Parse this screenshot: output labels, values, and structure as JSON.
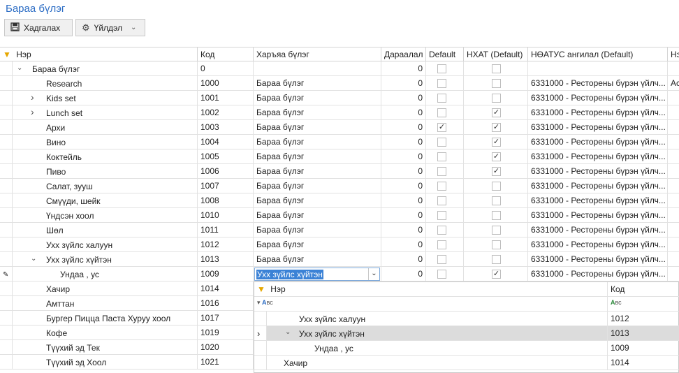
{
  "window": {
    "title": "Бараа бүлэг"
  },
  "toolbar": {
    "close_label": "Хадгалах",
    "actions_label": "Үйлдэл"
  },
  "columns": [
    "Нэр",
    "Код",
    "Харъяа бүлэг",
    "Дараалал",
    "Default",
    "НХАТ (Default)",
    "НӨАТУС ангилал (Default)",
    "Нэ"
  ],
  "rows": [
    {
      "name": "Бараа бүлэг",
      "code": "0",
      "parent": "",
      "order": "0",
      "def": false,
      "nhat": false,
      "vat": "",
      "extra": "",
      "level": 0,
      "expander": "down"
    },
    {
      "name": "Research",
      "code": "1000",
      "parent": "Бараа бүлэг",
      "order": "0",
      "def": false,
      "nhat": false,
      "vat": "6331000 - Ресторены бүрэн үйлч...",
      "extra": "Ac",
      "level": 1,
      "expander": ""
    },
    {
      "name": "Kids set",
      "code": "1001",
      "parent": "Бараа бүлэг",
      "order": "0",
      "def": false,
      "nhat": false,
      "vat": "6331000 - Ресторены бүрэн үйлч...",
      "extra": "",
      "level": 1,
      "expander": "right"
    },
    {
      "name": "Lunch set",
      "code": "1002",
      "parent": "Бараа бүлэг",
      "order": "0",
      "def": false,
      "nhat": true,
      "vat": "6331000 - Ресторены бүрэн үйлч...",
      "extra": "",
      "level": 1,
      "expander": "right"
    },
    {
      "name": "Архи",
      "code": "1003",
      "parent": "Бараа бүлэг",
      "order": "0",
      "def": true,
      "nhat": true,
      "vat": "6331000 - Ресторены бүрэн үйлч...",
      "extra": "",
      "level": 1,
      "expander": ""
    },
    {
      "name": "Вино",
      "code": "1004",
      "parent": "Бараа бүлэг",
      "order": "0",
      "def": false,
      "nhat": true,
      "vat": "6331000 - Ресторены бүрэн үйлч...",
      "extra": "",
      "level": 1,
      "expander": ""
    },
    {
      "name": "Коктейль",
      "code": "1005",
      "parent": "Бараа бүлэг",
      "order": "0",
      "def": false,
      "nhat": true,
      "vat": "6331000 - Ресторены бүрэн үйлч...",
      "extra": "",
      "level": 1,
      "expander": ""
    },
    {
      "name": "Пиво",
      "code": "1006",
      "parent": "Бараа бүлэг",
      "order": "0",
      "def": false,
      "nhat": true,
      "vat": "6331000 - Ресторены бүрэн үйлч...",
      "extra": "",
      "level": 1,
      "expander": ""
    },
    {
      "name": "Салат, зууш",
      "code": "1007",
      "parent": "Бараа бүлэг",
      "order": "0",
      "def": false,
      "nhat": false,
      "vat": "6331000 - Ресторены бүрэн үйлч...",
      "extra": "",
      "level": 1,
      "expander": ""
    },
    {
      "name": "Смүүди, шейк",
      "code": "1008",
      "parent": "Бараа бүлэг",
      "order": "0",
      "def": false,
      "nhat": false,
      "vat": "6331000 - Ресторены бүрэн үйлч...",
      "extra": "",
      "level": 1,
      "expander": ""
    },
    {
      "name": "Үндсэн хоол",
      "code": "1010",
      "parent": "Бараа бүлэг",
      "order": "0",
      "def": false,
      "nhat": false,
      "vat": "6331000 - Ресторены бүрэн үйлч...",
      "extra": "",
      "level": 1,
      "expander": ""
    },
    {
      "name": "Шөл",
      "code": "1011",
      "parent": "Бараа бүлэг",
      "order": "0",
      "def": false,
      "nhat": false,
      "vat": "6331000 - Ресторены бүрэн үйлч...",
      "extra": "",
      "level": 1,
      "expander": ""
    },
    {
      "name": "Ухх зүйлс халуун",
      "code": "1012",
      "parent": "Бараа бүлэг",
      "order": "0",
      "def": false,
      "nhat": false,
      "vat": "6331000 - Ресторены бүрэн үйлч...",
      "extra": "",
      "level": 1,
      "expander": ""
    },
    {
      "name": "Ухх зүйлс хүйтэн",
      "code": "1013",
      "parent": "Бараа бүлэг",
      "order": "0",
      "def": false,
      "nhat": false,
      "vat": "6331000 - Ресторены бүрэн үйлч...",
      "extra": "",
      "level": 1,
      "expander": "down"
    },
    {
      "name": "Ундаа , ус",
      "code": "1009",
      "parent": "Ухх зүйлс хүйтэн",
      "order": "0",
      "def": false,
      "nhat": true,
      "vat": "6331000 - Ресторены бүрэн үйлч...",
      "extra": "",
      "level": 2,
      "expander": "",
      "editing": true
    },
    {
      "name": "Хачир",
      "code": "1014",
      "level": 1
    },
    {
      "name": "Амттан",
      "code": "1016",
      "level": 1
    },
    {
      "name": "Бургер Пицца Паста Хуруу хоол",
      "code": "1017",
      "level": 1
    },
    {
      "name": "Кофе",
      "code": "1019",
      "level": 1
    },
    {
      "name": "Түүхий эд Тек",
      "code": "1020",
      "level": 1
    },
    {
      "name": "Түүхий эд Хоол",
      "code": "1021",
      "level": 1
    }
  ],
  "dropdown": {
    "headers": [
      "Нэр",
      "Код"
    ],
    "filter_icon_labels": [
      "вс",
      "вс"
    ],
    "rows": [
      {
        "name": "Ухх зүйлс халуун",
        "code": "1012",
        "level": 1,
        "expander": "",
        "selected": false,
        "current": false
      },
      {
        "name": "Ухх зүйлс хүйтэн",
        "code": "1013",
        "level": 1,
        "expander": "down",
        "selected": true,
        "current": true
      },
      {
        "name": "Ундаа , ус",
        "code": "1009",
        "level": 2,
        "expander": "",
        "selected": false,
        "current": false
      },
      {
        "name": "Хачир",
        "code": "1014",
        "level": 0,
        "expander": "",
        "selected": false,
        "current": false
      }
    ]
  }
}
